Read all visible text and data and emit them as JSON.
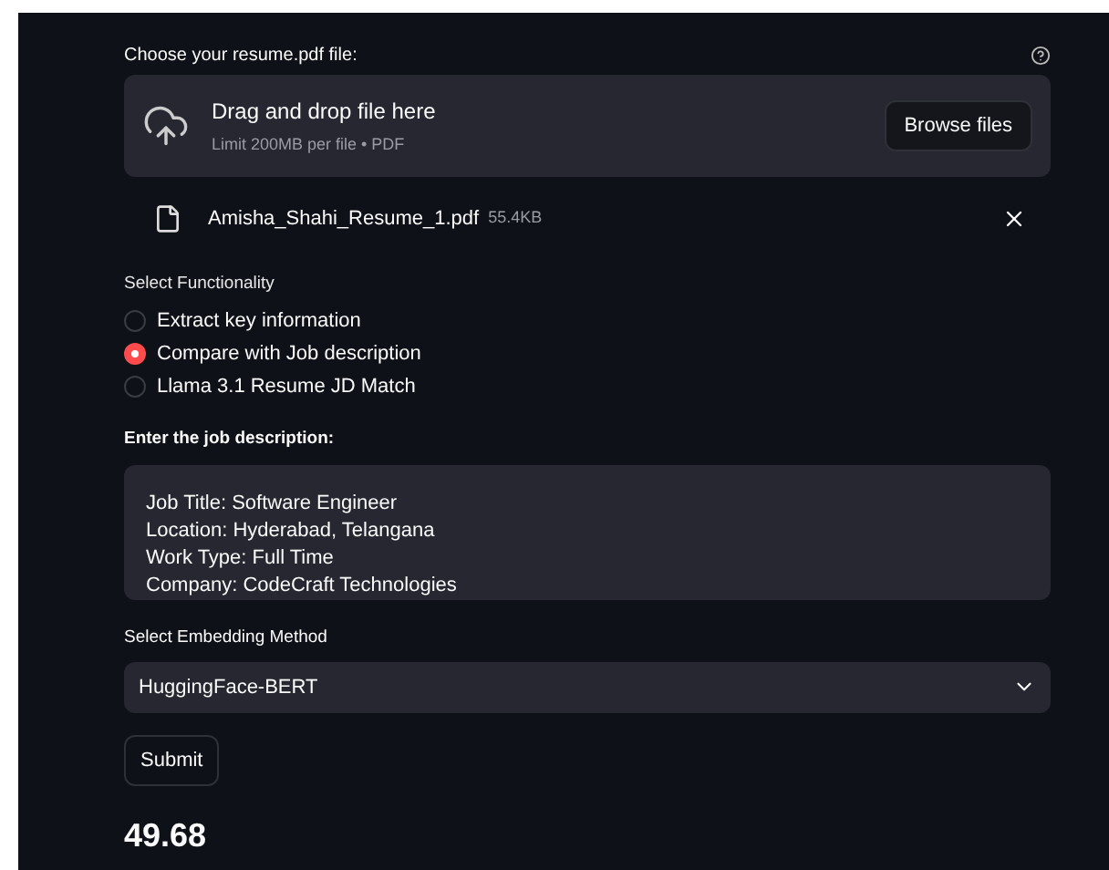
{
  "uploader": {
    "label": "Choose your resume.pdf file:",
    "drop_title": "Drag and drop file here",
    "drop_hint": "Limit 200MB per file • PDF",
    "browse_button": "Browse files"
  },
  "file": {
    "name": "Amisha_Shahi_Resume_1.pdf",
    "size": "55.4KB"
  },
  "functionality": {
    "label": "Select Functionality",
    "options": [
      {
        "label": "Extract key information",
        "selected": false
      },
      {
        "label": "Compare with Job description",
        "selected": true
      },
      {
        "label": "Llama 3.1 Resume JD Match",
        "selected": false
      }
    ]
  },
  "job_description": {
    "label": "Enter the job description:",
    "lines": [
      "Job Title: Software Engineer",
      "Location: Hyderabad, Telangana",
      "Work Type: Full Time",
      "Company: CodeCraft Technologies"
    ]
  },
  "embedding": {
    "label": "Select Embedding Method",
    "value": "HuggingFace-BERT"
  },
  "submit_button": "Submit",
  "score": "49.68"
}
